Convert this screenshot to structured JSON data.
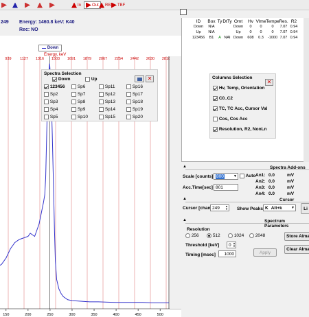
{
  "toolbar": {
    "buttons": [
      {
        "name": "toolbar-btn-1",
        "label": "",
        "icon": "play-icon"
      },
      {
        "name": "toolbar-btn-2",
        "label": "",
        "icon": "cross-icon"
      },
      {
        "name": "toolbar-btn-3",
        "label": "",
        "icon": "star-icon"
      },
      {
        "name": "toolbar-btn-4",
        "label": "",
        "icon": "arrow-icon"
      },
      {
        "name": "toolbar-btn-5",
        "label": "",
        "icon": "square-icon"
      },
      {
        "name": "toolbar-in",
        "label": "In",
        "icon": "in-icon"
      },
      {
        "name": "toolbar-out",
        "label": "Out",
        "icon": "out-icon"
      },
      {
        "name": "toolbar-rb",
        "label": "RB",
        "icon": "rb-icon"
      },
      {
        "name": "toolbar-tbf",
        "label": "TBF",
        "icon": "tbf-icon"
      }
    ]
  },
  "status": {
    "left_value": "249",
    "energy": "Energy: 1460.8 keV: K40",
    "rec": "Rec:  NO"
  },
  "legend": {
    "label": "Down"
  },
  "energy_axis": {
    "label": "Energy, keV",
    "ticks": [
      "939",
      "1127",
      "1316",
      "1503",
      "1691",
      "1879",
      "2067",
      "2254",
      "2442",
      "2630",
      "2818"
    ]
  },
  "x_axis": {
    "ticks": [
      "150",
      "200",
      "250",
      "300",
      "350",
      "400",
      "450",
      "500"
    ]
  },
  "spectra_selection": {
    "title": "Spectra Selection",
    "top_items": [
      {
        "label": "Down",
        "checked": true
      },
      {
        "label": "Up",
        "checked": false
      }
    ],
    "items": [
      [
        "123456",
        "Sp6",
        "Sp11",
        "Sp16"
      ],
      [
        "Sp2",
        "Sp7",
        "Sp12",
        "Sp17"
      ],
      [
        "Sp3",
        "Sp8",
        "Sp13",
        "Sp18"
      ],
      [
        "Sp4",
        "Sp9",
        "Sp14",
        "Sp19"
      ],
      [
        "Sp5",
        "Sp10",
        "Sp15",
        "Sp20"
      ]
    ],
    "checked": [
      "123456"
    ]
  },
  "table": {
    "headers": [
      "ID",
      "Box",
      "Ty",
      "DtTy",
      "Omt",
      "Hv",
      "Vlme",
      "Tempe",
      "Res.",
      "R2"
    ],
    "rows": [
      [
        "Down",
        "N/A",
        "",
        "",
        "Down",
        "0",
        "0",
        "0",
        "7.07",
        "0.94"
      ],
      [
        "Up",
        "N/A",
        "",
        "",
        "Up",
        "0",
        "0",
        "0",
        "7.07",
        "0.94"
      ],
      [
        "123456",
        "B1",
        "A",
        "NAI",
        "Down",
        "608",
        "0.3",
        "-1000",
        "7.07",
        "0.94"
      ]
    ]
  },
  "columns_selection": {
    "title": "Columns Selection",
    "items": [
      {
        "label": "Hv, Temp, Orientation",
        "checked": true
      },
      {
        "label": "C0..C2",
        "checked": true
      },
      {
        "label": "TC, TC Acc, Cursor Val",
        "checked": true
      },
      {
        "label": "Cos, Cos Acc",
        "checked": false
      },
      {
        "label": "Resolution, R2, NonLn",
        "checked": true
      }
    ]
  },
  "addons": {
    "title": "Spectra Add-ons",
    "scale_label": "Scale [counts]",
    "scale_value": "800",
    "auto_label": "Auto",
    "acc_label": "Acc.Time[sec]",
    "acc_value": "801",
    "an": [
      {
        "label": "An1:",
        "value": "0.0",
        "unit": "mV"
      },
      {
        "label": "An2:",
        "value": "0.0",
        "unit": "mV"
      },
      {
        "label": "An3:",
        "value": "0.0",
        "unit": "mV"
      },
      {
        "label": "An4:",
        "value": "0.0",
        "unit": "mV"
      }
    ]
  },
  "cursor": {
    "title": "Cursor",
    "label": "Cursor [chan]",
    "value": "249",
    "peaks_label": "Show Peaks",
    "peaks_value": "K",
    "peaks_option": "Alt+k",
    "list_button": "Li"
  },
  "params": {
    "title": "Spectrum Parameters",
    "resolution_label": "Resolution",
    "resolutions": [
      "256",
      "512",
      "1024",
      "2048"
    ],
    "selected": "512",
    "threshold_label": "Threshold [keV]",
    "threshold_value": "0",
    "timing_label": "Timing [msec]",
    "timing_value": "1000",
    "apply_label": "Apply",
    "store_label": "Store Alma",
    "clear_label": "Clear Alma"
  },
  "chart_data": {
    "type": "line",
    "x": [
      130,
      140,
      150,
      160,
      170,
      180,
      190,
      200,
      205,
      210,
      215,
      220,
      225,
      230,
      235,
      238,
      240,
      243,
      246,
      249,
      252,
      255,
      258,
      260,
      262,
      265,
      270,
      275,
      280,
      290,
      300,
      320,
      340,
      360,
      380,
      400,
      420,
      440,
      460,
      480,
      500,
      520
    ],
    "series": [
      {
        "values": [
          130,
          140,
          160,
          190,
          210,
          220,
          225,
          230,
          240,
          235,
          230,
          250,
          270,
          305,
          340,
          365,
          420,
          600,
          740,
          790,
          720,
          560,
          380,
          250,
          150,
          90,
          60,
          45,
          35,
          25,
          22,
          20,
          18,
          18,
          17,
          16,
          16,
          16,
          16,
          15,
          15,
          15
        ]
      }
    ],
    "xlim": [
      130,
      520
    ],
    "ylim": [
      0,
      800
    ],
    "colors": {
      "line": "#3333cc",
      "energy_grid": "#e8a0a0"
    }
  }
}
